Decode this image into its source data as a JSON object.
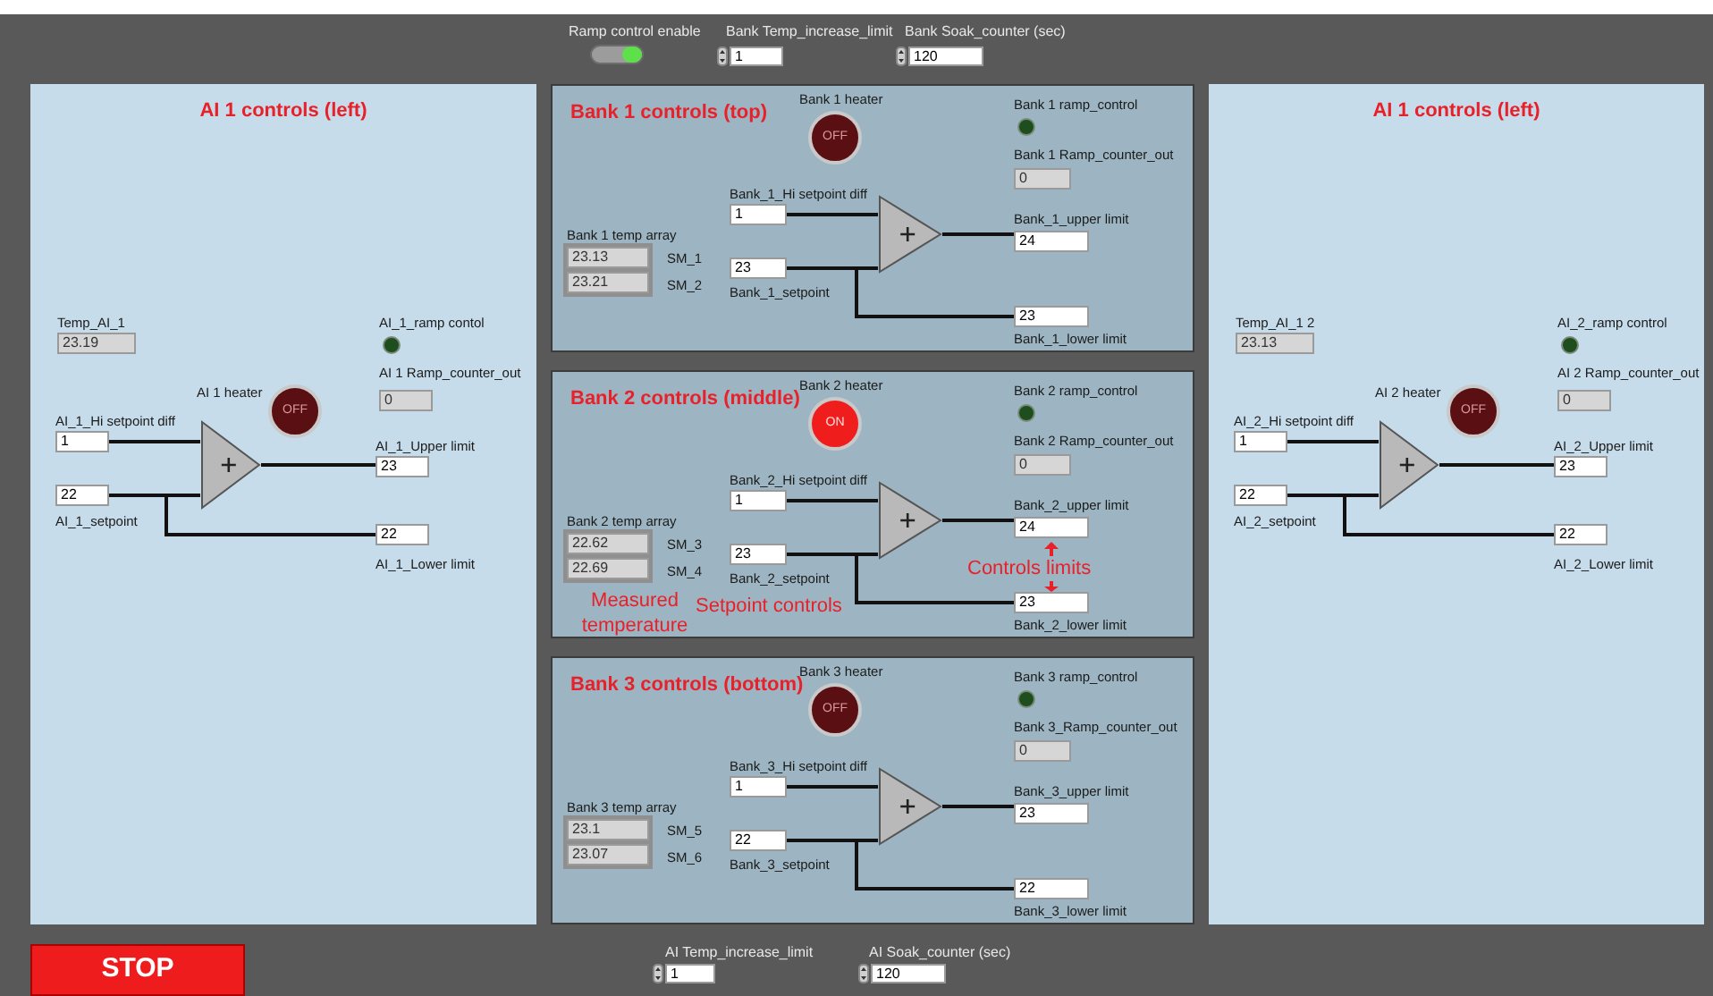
{
  "top_bar": {
    "ramp_control_enable": {
      "label": "Ramp control enable",
      "on": true
    },
    "numerics": [
      {
        "label": "Bank Temp_increase_limit",
        "value": "1"
      },
      {
        "label": "Bank Soak_counter (sec)",
        "value": "120"
      }
    ]
  },
  "ai_panels": [
    {
      "title": "AI 1 controls (left)",
      "temp": {
        "label": "Temp_AI_1",
        "value": "23.19"
      },
      "ramp_control": {
        "label": "AI_1_ramp contol",
        "on": false
      },
      "ramp_counter": {
        "label": "AI 1 Ramp_counter_out",
        "value": "0"
      },
      "heater": {
        "label": "AI 1 heater",
        "on": false,
        "text": "OFF"
      },
      "hi_diff": {
        "label": "AI_1_Hi setpoint diff",
        "value": "1"
      },
      "setpoint": {
        "label": "AI_1_setpoint",
        "value": "22"
      },
      "upper": {
        "label": "AI_1_Upper limit",
        "value": "23"
      },
      "lower": {
        "label": "AI_1_Lower limit",
        "value": "22"
      }
    },
    {
      "title": "AI 1 controls (left)",
      "temp": {
        "label": "Temp_AI_1 2",
        "value": "23.13"
      },
      "ramp_control": {
        "label": "AI_2_ramp control",
        "on": false
      },
      "ramp_counter": {
        "label": "AI 2 Ramp_counter_out",
        "value": "0"
      },
      "heater": {
        "label": "AI 2 heater",
        "on": false,
        "text": "OFF"
      },
      "hi_diff": {
        "label": "AI_2_Hi setpoint diff",
        "value": "1"
      },
      "setpoint": {
        "label": "AI_2_setpoint",
        "value": "22"
      },
      "upper": {
        "label": "AI_2_Upper limit",
        "value": "23"
      },
      "lower": {
        "label": "AI_2_Lower limit",
        "value": "22"
      }
    }
  ],
  "banks": [
    {
      "title": "Bank 1 controls (top)",
      "heater": {
        "label": "Bank 1 heater",
        "on": false,
        "text": "OFF"
      },
      "ramp_control": {
        "label": "Bank 1 ramp_control",
        "on": false
      },
      "ramp_counter": {
        "label": "Bank 1 Ramp_counter_out",
        "value": "0"
      },
      "temp_array": {
        "label": "Bank 1 temp array",
        "items": [
          {
            "value": "23.13",
            "sensor": "SM_1"
          },
          {
            "value": "23.21",
            "sensor": "SM_2"
          }
        ]
      },
      "hi_diff": {
        "label": "Bank_1_Hi setpoint diff",
        "value": "1"
      },
      "setpoint": {
        "label": "Bank_1_setpoint",
        "value": "23"
      },
      "upper": {
        "label": "Bank_1_upper limit",
        "value": "24"
      },
      "lower": {
        "label": "Bank_1_lower limit",
        "value": "23"
      }
    },
    {
      "title": "Bank 2 controls (middle)",
      "heater": {
        "label": "Bank 2 heater",
        "on": true,
        "text": "ON"
      },
      "ramp_control": {
        "label": "Bank 2 ramp_control",
        "on": false
      },
      "ramp_counter": {
        "label": "Bank 2 Ramp_counter_out",
        "value": "0"
      },
      "temp_array": {
        "label": "Bank 2 temp array",
        "items": [
          {
            "value": "22.62",
            "sensor": "SM_3"
          },
          {
            "value": "22.69",
            "sensor": "SM_4"
          }
        ]
      },
      "hi_diff": {
        "label": "Bank_2_Hi setpoint diff",
        "value": "1"
      },
      "setpoint": {
        "label": "Bank_2_setpoint",
        "value": "23"
      },
      "upper": {
        "label": "Bank_2_upper limit",
        "value": "24"
      },
      "lower": {
        "label": "Bank_2_lower limit",
        "value": "23"
      },
      "annotations": [
        {
          "kind": "measured",
          "text": "Measured temperature"
        },
        {
          "kind": "setpoint",
          "text": "Setpoint controls"
        },
        {
          "kind": "limits",
          "text": "Controls limits"
        }
      ]
    },
    {
      "title": "Bank 3 controls (bottom)",
      "heater": {
        "label": "Bank 3 heater",
        "on": false,
        "text": "OFF"
      },
      "ramp_control": {
        "label": "Bank 3  ramp_control",
        "on": false
      },
      "ramp_counter": {
        "label": "Bank 3_Ramp_counter_out",
        "value": "0"
      },
      "temp_array": {
        "label": "Bank 3 temp array",
        "items": [
          {
            "value": "23.1",
            "sensor": "SM_5"
          },
          {
            "value": "23.07",
            "sensor": "SM_6"
          }
        ]
      },
      "hi_diff": {
        "label": "Bank_3_Hi setpoint diff",
        "value": "1"
      },
      "setpoint": {
        "label": "Bank_3_setpoint",
        "value": "22"
      },
      "upper": {
        "label": "Bank_3_upper limit",
        "value": "23"
      },
      "lower": {
        "label": "Bank_3_lower limit",
        "value": "22"
      }
    }
  ],
  "bottom_bar": {
    "stop_button": {
      "label": "STOP"
    },
    "numerics": [
      {
        "label": "AI Temp_increase_limit",
        "value": "1"
      },
      {
        "label": "AI Soak_counter (sec)",
        "value": "120"
      }
    ]
  }
}
